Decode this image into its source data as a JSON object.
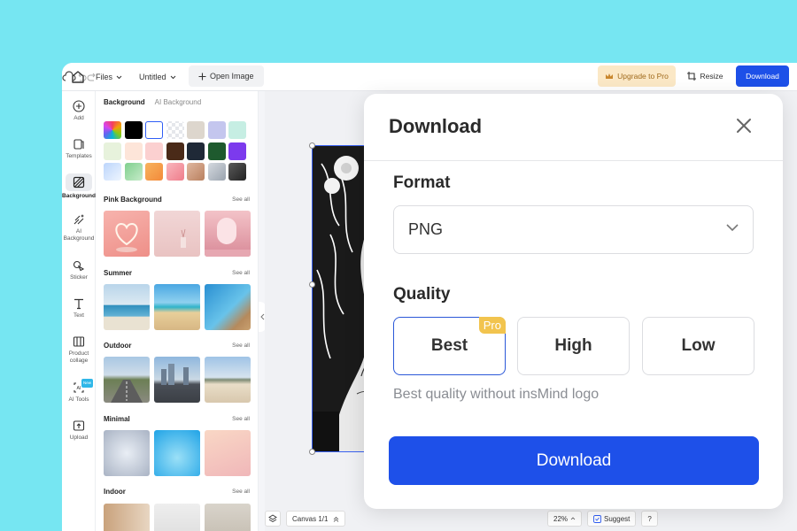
{
  "topbar": {
    "files_label": "Files",
    "untitled_label": "Untitled",
    "open_image_label": "Open Image",
    "upgrade_label": "Upgrade to Pro",
    "resize_label": "Resize",
    "download_label": "Download"
  },
  "rail": {
    "items": [
      {
        "label": "Add",
        "icon": "plus-circle-icon"
      },
      {
        "label": "Templates",
        "icon": "template-icon"
      },
      {
        "label": "Background",
        "icon": "background-icon"
      },
      {
        "label": "AI Background",
        "icon": "ai-sparkle-icon"
      },
      {
        "label": "Sticker",
        "icon": "sticker-icon"
      },
      {
        "label": "Text",
        "icon": "text-icon"
      },
      {
        "label": "Product collage",
        "icon": "collage-icon"
      },
      {
        "label": "AI Tools",
        "icon": "ai-tools-icon"
      },
      {
        "label": "Upload",
        "icon": "upload-icon"
      }
    ],
    "new_badge": "New"
  },
  "panel": {
    "tab_background": "Background",
    "tab_ai_background": "AI Background",
    "swatch_colors": [
      "rainbow",
      "#000000",
      "#ffffff",
      "transparent",
      "#ddd6cd",
      "#c4c6ee",
      "#c6eee3",
      "#e7f2dc",
      "#fde5d9",
      "#fbd0d0",
      "#4a2a18",
      "#1f2937",
      "#1e5a2e",
      "#7c3aed",
      "#cfe1fb",
      "#9fd9a7",
      "#f6a14b",
      "#f59aa4",
      "#cf9a7f",
      "#b8bfc8",
      "#3a3a3a"
    ],
    "sections": [
      {
        "title": "Pink Background",
        "see_all": "See all"
      },
      {
        "title": "Summer",
        "see_all": "See all"
      },
      {
        "title": "Outdoor",
        "see_all": "See all"
      },
      {
        "title": "Minimal",
        "see_all": "See all"
      },
      {
        "title": "Indoor",
        "see_all": "See all"
      }
    ]
  },
  "canvas": {
    "canvas_label": "Canvas 1/1",
    "zoom_label": "22%",
    "suggest_label": "Suggest",
    "help_label": "?"
  },
  "modal": {
    "title": "Download",
    "format_label": "Format",
    "format_value": "PNG",
    "quality_label": "Quality",
    "quality_options": [
      "Best",
      "High",
      "Low"
    ],
    "selected_quality": "Best",
    "pro_badge": "Pro",
    "quality_note": "Best quality without insMind logo",
    "download_button": "Download"
  },
  "colors": {
    "page_background": "#76e6f2",
    "accent_blue": "#1e50e9",
    "upgrade_bg": "#fbe8c6",
    "pro_badge": "#f2c44e"
  }
}
